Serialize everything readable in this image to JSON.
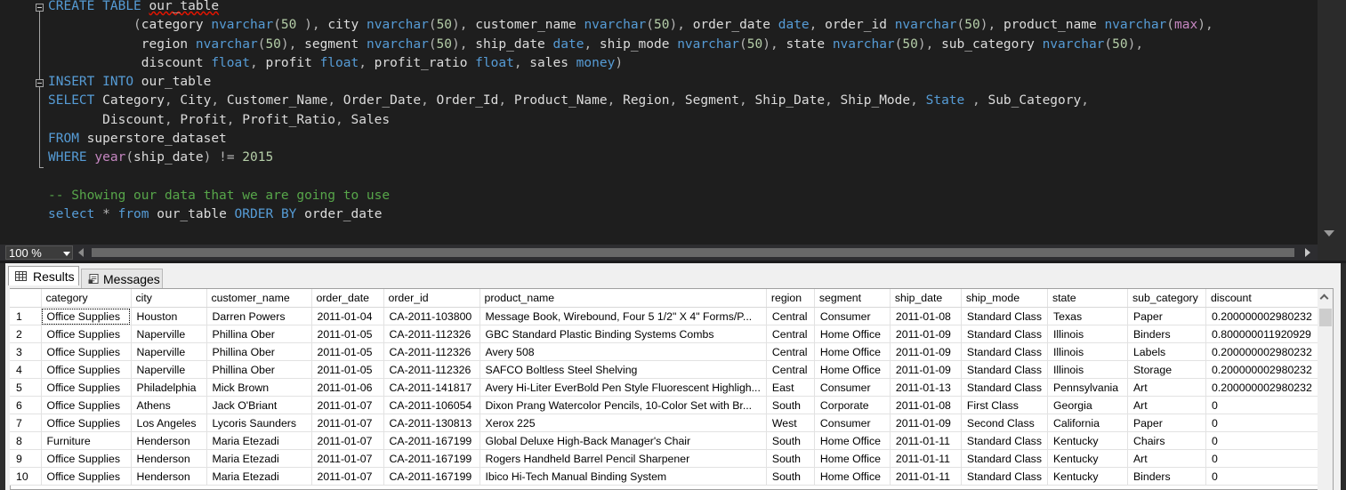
{
  "editor": {
    "lines": [
      [
        [
          "kw",
          "CREATE"
        ],
        [
          "id",
          " "
        ],
        [
          "kw",
          "TABLE"
        ],
        [
          "id",
          " "
        ],
        [
          "sq",
          "our_table"
        ]
      ],
      [
        [
          "id",
          "           "
        ],
        [
          "op",
          "("
        ],
        [
          "id",
          "category "
        ],
        [
          "kw",
          "nvarchar"
        ],
        [
          "op",
          "("
        ],
        [
          "num",
          "50"
        ],
        [
          "op",
          " ),"
        ],
        [
          "id",
          " city "
        ],
        [
          "kw",
          "nvarchar"
        ],
        [
          "op",
          "("
        ],
        [
          "num",
          "50"
        ],
        [
          "op",
          "),"
        ],
        [
          "id",
          " customer_name "
        ],
        [
          "kw",
          "nvarchar"
        ],
        [
          "op",
          "("
        ],
        [
          "num",
          "50"
        ],
        [
          "op",
          "),"
        ],
        [
          "id",
          " order_date "
        ],
        [
          "kw",
          "date"
        ],
        [
          "op",
          ","
        ],
        [
          "id",
          " order_id "
        ],
        [
          "kw",
          "nvarchar"
        ],
        [
          "op",
          "("
        ],
        [
          "num",
          "50"
        ],
        [
          "op",
          "),"
        ],
        [
          "id",
          " product_name "
        ],
        [
          "kw",
          "nvarchar"
        ],
        [
          "op",
          "("
        ],
        [
          "fn",
          "max"
        ],
        [
          "op",
          "),"
        ]
      ],
      [
        [
          "id",
          "            region "
        ],
        [
          "kw",
          "nvarchar"
        ],
        [
          "op",
          "("
        ],
        [
          "num",
          "50"
        ],
        [
          "op",
          "),"
        ],
        [
          "id",
          " segment "
        ],
        [
          "kw",
          "nvarchar"
        ],
        [
          "op",
          "("
        ],
        [
          "num",
          "50"
        ],
        [
          "op",
          "),"
        ],
        [
          "id",
          " ship_date "
        ],
        [
          "kw",
          "date"
        ],
        [
          "op",
          ","
        ],
        [
          "id",
          " ship_mode "
        ],
        [
          "kw",
          "nvarchar"
        ],
        [
          "op",
          "("
        ],
        [
          "num",
          "50"
        ],
        [
          "op",
          "),"
        ],
        [
          "id",
          " state "
        ],
        [
          "kw",
          "nvarchar"
        ],
        [
          "op",
          "("
        ],
        [
          "num",
          "50"
        ],
        [
          "op",
          "),"
        ],
        [
          "id",
          " sub_category "
        ],
        [
          "kw",
          "nvarchar"
        ],
        [
          "op",
          "("
        ],
        [
          "num",
          "50"
        ],
        [
          "op",
          "),"
        ]
      ],
      [
        [
          "id",
          "            discount "
        ],
        [
          "kw",
          "float"
        ],
        [
          "op",
          ","
        ],
        [
          "id",
          " profit "
        ],
        [
          "kw",
          "float"
        ],
        [
          "op",
          ","
        ],
        [
          "id",
          " profit_ratio "
        ],
        [
          "kw",
          "float"
        ],
        [
          "op",
          ","
        ],
        [
          "id",
          " sales "
        ],
        [
          "kw",
          "money"
        ],
        [
          "op",
          ")"
        ]
      ],
      [
        [
          "kw",
          "INSERT"
        ],
        [
          "id",
          " "
        ],
        [
          "kw",
          "INTO"
        ],
        [
          "id",
          " our_table"
        ]
      ],
      [
        [
          "kw",
          "SELECT"
        ],
        [
          "id",
          " Category"
        ],
        [
          "op",
          ","
        ],
        [
          "id",
          " City"
        ],
        [
          "op",
          ","
        ],
        [
          "id",
          " Customer_Name"
        ],
        [
          "op",
          ","
        ],
        [
          "id",
          " Order_Date"
        ],
        [
          "op",
          ","
        ],
        [
          "id",
          " Order_Id"
        ],
        [
          "op",
          ","
        ],
        [
          "id",
          " Product_Name"
        ],
        [
          "op",
          ","
        ],
        [
          "id",
          " Region"
        ],
        [
          "op",
          ","
        ],
        [
          "id",
          " Segment"
        ],
        [
          "op",
          ","
        ],
        [
          "id",
          " Ship_Date"
        ],
        [
          "op",
          ","
        ],
        [
          "id",
          " Ship_Mode"
        ],
        [
          "op",
          ","
        ],
        [
          "id",
          " "
        ],
        [
          "kw",
          "State"
        ],
        [
          "id",
          " "
        ],
        [
          "op",
          ","
        ],
        [
          "id",
          " Sub_Category"
        ],
        [
          "op",
          ","
        ]
      ],
      [
        [
          "id",
          "       Discount"
        ],
        [
          "op",
          ","
        ],
        [
          "id",
          " Profit"
        ],
        [
          "op",
          ","
        ],
        [
          "id",
          " Profit_Ratio"
        ],
        [
          "op",
          ","
        ],
        [
          "id",
          " Sales"
        ]
      ],
      [
        [
          "kw",
          "FROM"
        ],
        [
          "id",
          " superstore_dataset"
        ]
      ],
      [
        [
          "kw",
          "WHERE"
        ],
        [
          "id",
          " "
        ],
        [
          "fn",
          "year"
        ],
        [
          "op",
          "("
        ],
        [
          "id",
          "ship_date"
        ],
        [
          "op",
          ")"
        ],
        [
          "id",
          " "
        ],
        [
          "op",
          "!="
        ],
        [
          "id",
          " "
        ],
        [
          "num",
          "2015"
        ]
      ],
      [],
      [
        [
          "cmt",
          "-- Showing our data that we are going to use"
        ]
      ],
      [
        [
          "kw",
          "select"
        ],
        [
          "id",
          " "
        ],
        [
          "op",
          "*"
        ],
        [
          "id",
          " "
        ],
        [
          "kw",
          "from"
        ],
        [
          "id",
          " our_table "
        ],
        [
          "kw",
          "ORDER"
        ],
        [
          "id",
          " "
        ],
        [
          "kw",
          "BY"
        ],
        [
          "id",
          " order_date"
        ]
      ]
    ]
  },
  "zoom": {
    "label": "100 %"
  },
  "tabs": {
    "results": "Results",
    "messages": "Messages"
  },
  "grid": {
    "columns": [
      "category",
      "city",
      "customer_name",
      "order_date",
      "order_id",
      "product_name",
      "region",
      "segment",
      "ship_date",
      "ship_mode",
      "state",
      "sub_category",
      "discount"
    ],
    "rows": [
      [
        "1",
        "Office Supplies",
        "Houston",
        "Darren Powers",
        "2011-01-04",
        "CA-2011-103800",
        "Message Book, Wirebound, Four 5 1/2\" X 4\" Forms/P...",
        "Central",
        "Consumer",
        "2011-01-08",
        "Standard Class",
        "Texas",
        "Paper",
        "0.200000002980232"
      ],
      [
        "2",
        "Office Supplies",
        "Naperville",
        "Phillina Ober",
        "2011-01-05",
        "CA-2011-112326",
        "GBC Standard Plastic Binding Systems Combs",
        "Central",
        "Home Office",
        "2011-01-09",
        "Standard Class",
        "Illinois",
        "Binders",
        "0.800000011920929"
      ],
      [
        "3",
        "Office Supplies",
        "Naperville",
        "Phillina Ober",
        "2011-01-05",
        "CA-2011-112326",
        "Avery 508",
        "Central",
        "Home Office",
        "2011-01-09",
        "Standard Class",
        "Illinois",
        "Labels",
        "0.200000002980232"
      ],
      [
        "4",
        "Office Supplies",
        "Naperville",
        "Phillina Ober",
        "2011-01-05",
        "CA-2011-112326",
        "SAFCO Boltless Steel Shelving",
        "Central",
        "Home Office",
        "2011-01-09",
        "Standard Class",
        "Illinois",
        "Storage",
        "0.200000002980232"
      ],
      [
        "5",
        "Office Supplies",
        "Philadelphia",
        "Mick Brown",
        "2011-01-06",
        "CA-2011-141817",
        "Avery Hi-Liter EverBold Pen Style Fluorescent Highligh...",
        "East",
        "Consumer",
        "2011-01-13",
        "Standard Class",
        "Pennsylvania",
        "Art",
        "0.200000002980232"
      ],
      [
        "6",
        "Office Supplies",
        "Athens",
        "Jack O'Briant",
        "2011-01-07",
        "CA-2011-106054",
        "Dixon Prang Watercolor Pencils, 10-Color Set with Br...",
        "South",
        "Corporate",
        "2011-01-08",
        "First Class",
        "Georgia",
        "Art",
        "0"
      ],
      [
        "7",
        "Office Supplies",
        "Los Angeles",
        "Lycoris Saunders",
        "2011-01-07",
        "CA-2011-130813",
        "Xerox 225",
        "West",
        "Consumer",
        "2011-01-09",
        "Second Class",
        "California",
        "Paper",
        "0"
      ],
      [
        "8",
        "Furniture",
        "Henderson",
        "Maria Etezadi",
        "2011-01-07",
        "CA-2011-167199",
        "Global Deluxe High-Back Manager's Chair",
        "South",
        "Home Office",
        "2011-01-11",
        "Standard Class",
        "Kentucky",
        "Chairs",
        "0"
      ],
      [
        "9",
        "Office Supplies",
        "Henderson",
        "Maria Etezadi",
        "2011-01-07",
        "CA-2011-167199",
        "Rogers Handheld Barrel Pencil Sharpener",
        "South",
        "Home Office",
        "2011-01-11",
        "Standard Class",
        "Kentucky",
        "Art",
        "0"
      ],
      [
        "10",
        "Office Supplies",
        "Henderson",
        "Maria Etezadi",
        "2011-01-07",
        "CA-2011-167199",
        "Ibico Hi-Tech Manual Binding System",
        "South",
        "Home Office",
        "2011-01-11",
        "Standard Class",
        "Kentucky",
        "Binders",
        "0"
      ]
    ]
  }
}
